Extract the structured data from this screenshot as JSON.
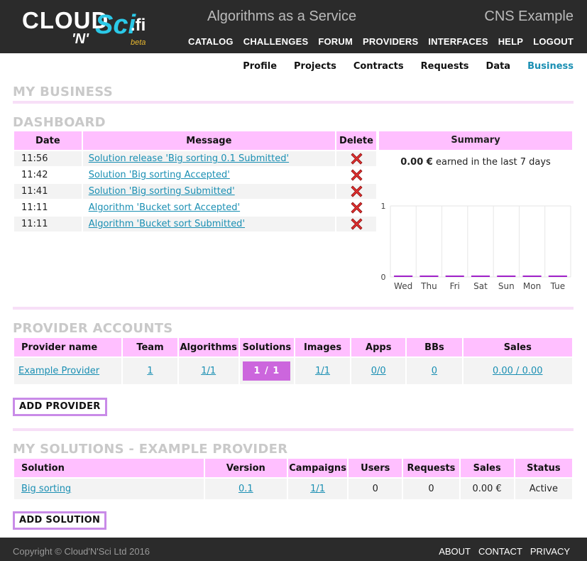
{
  "header": {
    "logo": {
      "cloud": "CLOUD",
      "n": "'N'",
      "sci": "Sci",
      "fi": ".fi",
      "beta": "beta"
    },
    "tagline": "Algorithms as a Service",
    "example": "CNS Example",
    "nav": [
      "CATALOG",
      "CHALLENGES",
      "FORUM",
      "PROVIDERS",
      "INTERFACES",
      "HELP",
      "LOGOUT"
    ]
  },
  "subnav": {
    "items": [
      "Profile",
      "Projects",
      "Contracts",
      "Requests",
      "Data",
      "Business"
    ],
    "active": "Business"
  },
  "page_title": "MY BUSINESS",
  "dashboard": {
    "title": "DASHBOARD",
    "headers": {
      "date": "Date",
      "message": "Message",
      "delete": "Delete"
    },
    "rows": [
      {
        "time": "11:56",
        "message": "Solution release 'Big sorting 0.1 Submitted'"
      },
      {
        "time": "11:42",
        "message": "Solution 'Big sorting Accepted'"
      },
      {
        "time": "11:41",
        "message": "Solution 'Big sorting Submitted'"
      },
      {
        "time": "11:11",
        "message": "Algorithm 'Bucket sort Accepted'"
      },
      {
        "time": "11:11",
        "message": "Algorithm 'Bucket sort Submitted'"
      }
    ],
    "summary": {
      "title": "Summary",
      "amount": "0.00 €",
      "earned_text": " earned in the last 7 days"
    }
  },
  "chart_data": {
    "type": "bar",
    "categories": [
      "Wed",
      "Thu",
      "Fri",
      "Sat",
      "Sun",
      "Mon",
      "Tue"
    ],
    "values": [
      0,
      0,
      0,
      0,
      0,
      0,
      0
    ],
    "ylim": [
      0,
      1
    ],
    "yticks": [
      "0",
      "1"
    ],
    "bar_color": "#a020c8",
    "grid": true
  },
  "provider_accounts": {
    "title": "PROVIDER ACCOUNTS",
    "headers": [
      "Provider name",
      "Team",
      "Algorithms",
      "Solutions",
      "Images",
      "Apps",
      "BBs",
      "Sales"
    ],
    "row": {
      "name": "Example Provider",
      "team": "1",
      "algorithms": "1/1",
      "solutions": "1 / 1",
      "images": "1/1",
      "apps": "0/0",
      "bbs": "0",
      "sales": "0.00 / 0.00"
    },
    "add_button": "ADD PROVIDER"
  },
  "solutions": {
    "title": "MY SOLUTIONS - EXAMPLE PROVIDER",
    "headers": [
      "Solution",
      "Version",
      "Campaigns",
      "Users",
      "Requests",
      "Sales",
      "Status"
    ],
    "row": {
      "name": "Big sorting",
      "version": "0.1",
      "campaigns": "1/1",
      "users": "0",
      "requests": "0",
      "sales": "0.00 €",
      "status": "Active"
    },
    "add_button": "ADD SOLUTION"
  },
  "footer": {
    "copyright": "Copyright © Cloud'N'Sci Ltd 2016",
    "links": [
      "ABOUT",
      "CONTACT",
      "PRIVACY"
    ]
  },
  "colors": {
    "header_bg": "#2b2b2b",
    "table_header": "#ffbfff",
    "accent": "#cc66dd",
    "link": "#1a8fb3"
  }
}
